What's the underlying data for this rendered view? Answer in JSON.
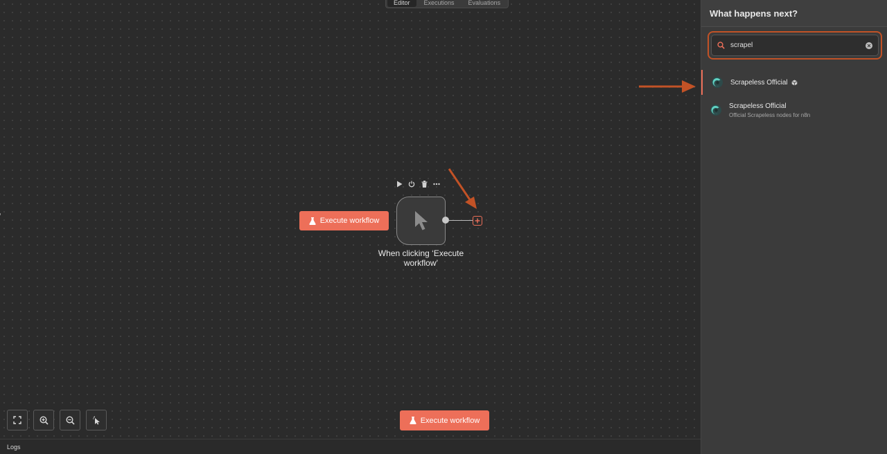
{
  "top_tabs": [
    {
      "label": "Editor",
      "active": true
    },
    {
      "label": "Executions",
      "active": false
    },
    {
      "label": "Evaluations",
      "active": false
    }
  ],
  "canvas": {
    "execute_button_label": "Execute workflow",
    "node": {
      "label": "When clicking ‘Execute workflow’",
      "icon": "cursor-icon",
      "toolbar": [
        "play-icon",
        "power-icon",
        "trash-icon",
        "more-icon"
      ]
    },
    "bottom_execute_label": "Execute workflow",
    "controls": [
      "fit-view-icon",
      "zoom-in-icon",
      "zoom-out-icon",
      "tidy-up-icon"
    ],
    "logs_label": "Logs"
  },
  "panel": {
    "title": "What happens next?",
    "search_value": "scrapel",
    "results": [
      {
        "title": "Scrapeless Official",
        "badge": "package-icon",
        "description": "",
        "selected": true
      },
      {
        "title": "Scrapeless Official",
        "badge": "",
        "description": "Official Scrapeless nodes for n8n",
        "selected": false
      }
    ]
  },
  "colors": {
    "accent": "#ed6f59",
    "annotation": "#c25226",
    "canvas_bg": "#2b2b2b",
    "panel_bg": "#3b3b3b"
  }
}
